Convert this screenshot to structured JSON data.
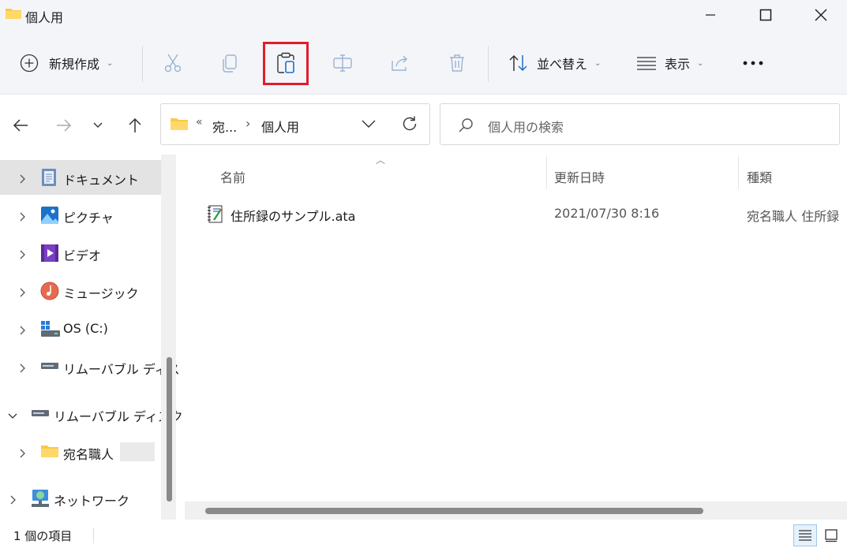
{
  "window": {
    "title": "個人用"
  },
  "toolbar": {
    "new_label": "新規作成",
    "sort_label": "並べ替え",
    "view_label": "表示",
    "highlight_color": "#e11d2a"
  },
  "address": {
    "overflow": "«",
    "crumb_1": "宛...",
    "crumb_2": "個人用"
  },
  "search": {
    "placeholder": "個人用の検索"
  },
  "sidebar": {
    "items": [
      {
        "label": "ドキュメント",
        "icon": "documents-icon"
      },
      {
        "label": "ピクチャ",
        "icon": "pictures-icon"
      },
      {
        "label": "ビデオ",
        "icon": "videos-icon"
      },
      {
        "label": "ミュージック",
        "icon": "music-icon"
      },
      {
        "label": "OS (C:)",
        "icon": "drive-c-icon"
      },
      {
        "label": "リムーバブル ディス",
        "icon": "removable-disk-icon"
      },
      {
        "label": "リムーバブル ディスク",
        "icon": "removable-disk-icon"
      },
      {
        "label": "宛名職人",
        "icon": "folder-icon"
      },
      {
        "label": "ネットワーク",
        "icon": "network-icon"
      }
    ]
  },
  "columns": {
    "name": "名前",
    "date": "更新日時",
    "type": "種類"
  },
  "files": [
    {
      "name": "住所録のサンプル.ata",
      "date": "2021/07/30 8:16",
      "type": "宛名職人 住所録"
    }
  ],
  "status": {
    "count": "1 個の項目"
  }
}
